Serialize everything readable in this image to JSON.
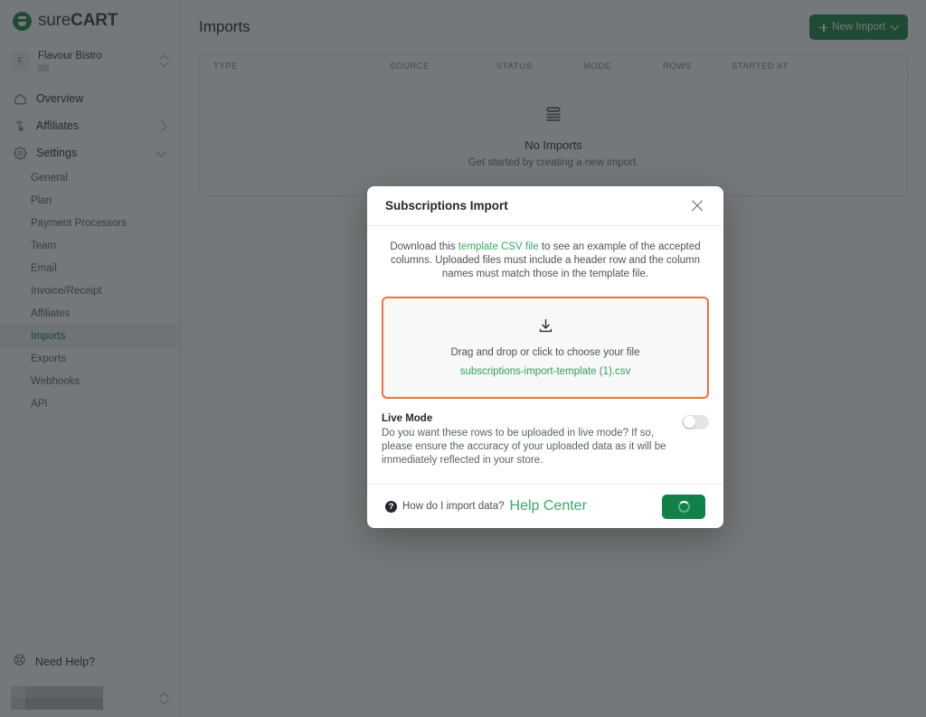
{
  "brand": {
    "name_light": "sure",
    "name_bold": "CART",
    "logo_color": "#1D8A4B"
  },
  "store_switcher": {
    "avatar_initial": "F",
    "name": "Flavour Bistro"
  },
  "sidebar": {
    "items": [
      {
        "label": "Overview",
        "icon": "home-icon",
        "expandable": false
      },
      {
        "label": "Affiliates",
        "icon": "click-cursor-icon",
        "expandable": "right"
      },
      {
        "label": "Settings",
        "icon": "gear-icon",
        "expandable": "down"
      }
    ],
    "settings_subitems": [
      {
        "label": "General",
        "active": false
      },
      {
        "label": "Plan",
        "active": false
      },
      {
        "label": "Payment Processors",
        "active": false
      },
      {
        "label": "Team",
        "active": false
      },
      {
        "label": "Email",
        "active": false
      },
      {
        "label": "Invoice/Receipt",
        "active": false
      },
      {
        "label": "Affiliates",
        "active": false
      },
      {
        "label": "Imports",
        "active": true
      },
      {
        "label": "Exports",
        "active": false
      },
      {
        "label": "Webhooks",
        "active": false
      },
      {
        "label": "API",
        "active": false
      }
    ],
    "help": {
      "label": "Need Help?",
      "icon": "lifebuoy-icon"
    }
  },
  "page": {
    "title": "Imports",
    "new_import_label": "New Import",
    "accent_color": "#1D8A4B"
  },
  "table": {
    "columns": [
      "TYPE",
      "SOURCE",
      "STATUS",
      "MODE",
      "ROWS",
      "STARTED AT"
    ],
    "rows": [],
    "empty_title": "No Imports",
    "empty_subtitle": "Get started by creating a new import."
  },
  "modal": {
    "title": "Subscriptions Import",
    "close_label": "Close",
    "intro_before": "Download this ",
    "intro_link": "template CSV file",
    "intro_after": " to see an example of the accepted columns. Uploaded files must include a header row and the column names must match those in the template file.",
    "dropzone": {
      "icon": "download-tray-icon",
      "hint": "Drag and drop or click to choose your file",
      "file_name": "subscriptions-import-template (1).csv",
      "border_color": "#F4703C",
      "file_color": "#2F9E5E"
    },
    "live_mode": {
      "title": "Live Mode",
      "description": "Do you want these rows to be uploaded in live mode? If so, please ensure the accuracy of your uploaded data as it will be immediately reflected in your store.",
      "enabled": false
    },
    "footer": {
      "question_icon": "question-mark-circle-icon",
      "question_text": "How do I import data?",
      "help_link": "Help Center",
      "submit_state": "loading",
      "submit_color": "#128049"
    }
  }
}
